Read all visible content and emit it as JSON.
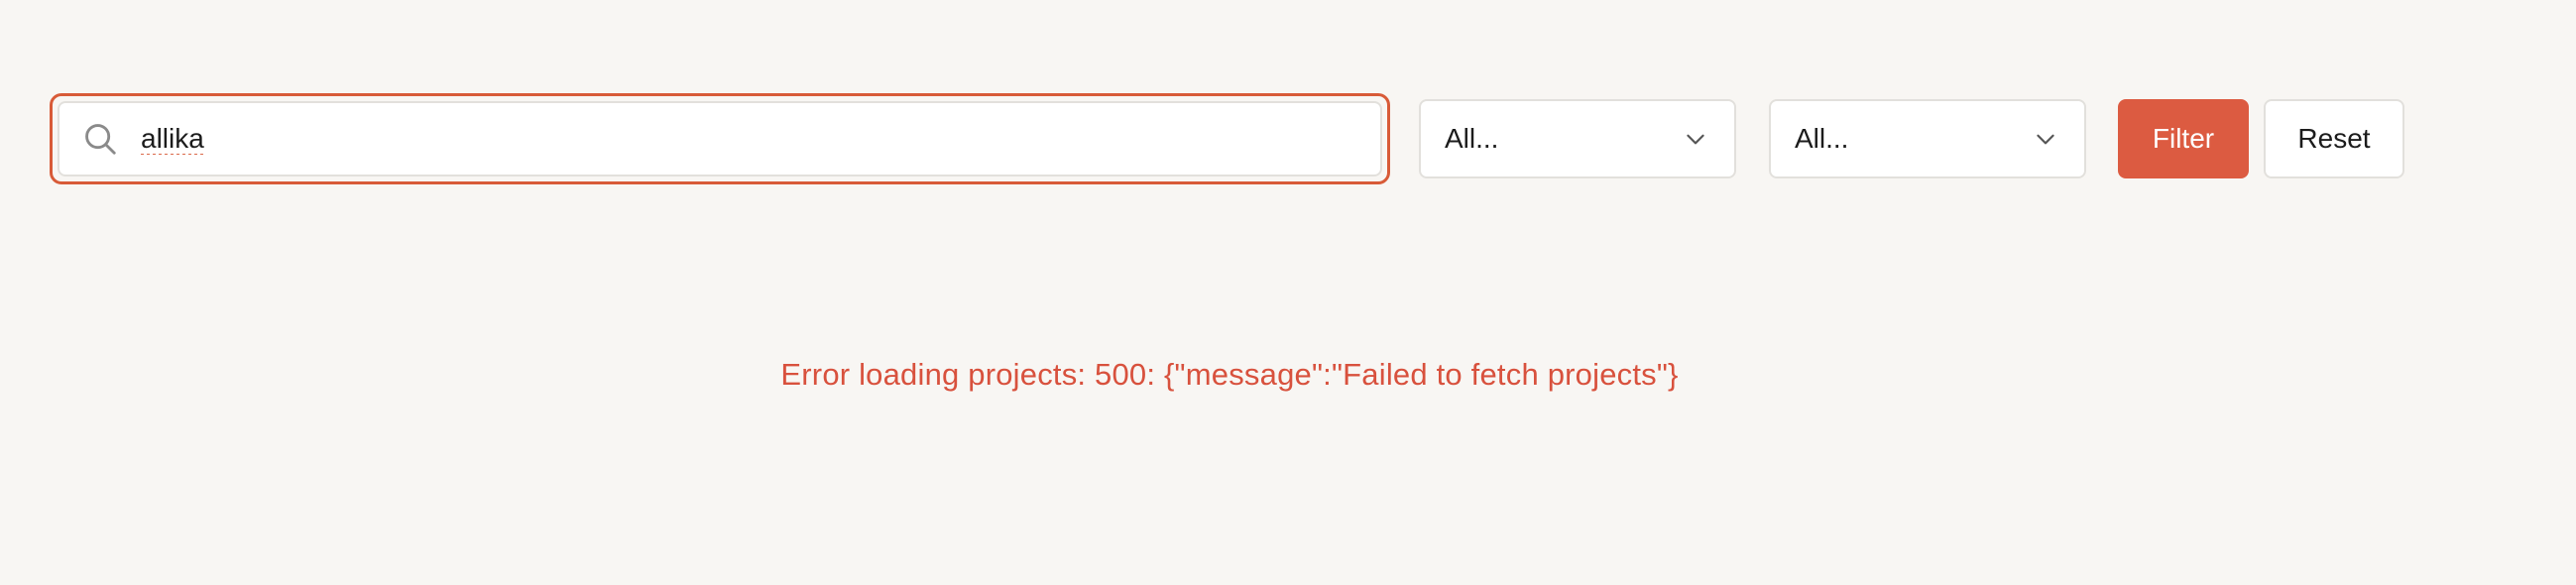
{
  "search": {
    "value": "allika",
    "icon": "search-icon"
  },
  "filters": [
    {
      "selected": "All...",
      "icon": "chevron-down-icon"
    },
    {
      "selected": "All...",
      "icon": "chevron-down-icon"
    }
  ],
  "buttons": {
    "filter_label": "Filter",
    "reset_label": "Reset"
  },
  "error": {
    "text": "Error loading projects: 500: {\"message\":\"Failed to fetch projects\"}"
  },
  "colors": {
    "background": "#f8f6f3",
    "accent": "#dc5b41",
    "focus_border": "#d85b38",
    "error_text": "#d8513d"
  }
}
